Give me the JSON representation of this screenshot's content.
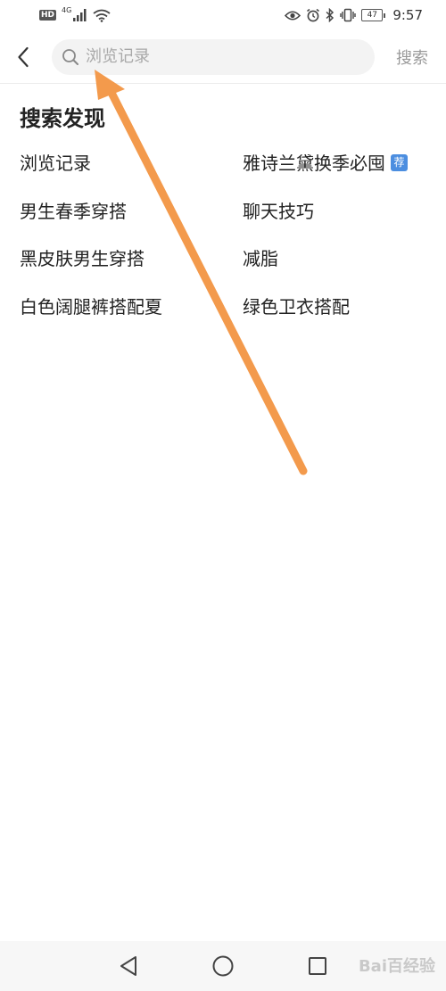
{
  "status_bar": {
    "hd": "HD",
    "network": "4G",
    "battery": "47",
    "time": "9:57"
  },
  "search": {
    "placeholder": "浏览记录",
    "value": "",
    "button_label": "搜索"
  },
  "discover": {
    "title": "搜索发现",
    "badge": "荐",
    "items": [
      {
        "label": "浏览记录"
      },
      {
        "label": "雅诗兰黛换季必囤"
      },
      {
        "label": "男生春季穿搭"
      },
      {
        "label": "聊天技巧"
      },
      {
        "label": "黑皮肤男生穿搭"
      },
      {
        "label": "减脂"
      },
      {
        "label": "白色阔腿裤搭配夏"
      },
      {
        "label": "绿色卫衣搭配"
      }
    ]
  },
  "watermark": {
    "text": "Bai百经验"
  },
  "colors": {
    "arrow": "#f39a4c",
    "badge": "#4c8ee0",
    "search_bg": "#f3f3f3",
    "nav_bg": "#f7f7f7"
  },
  "icons": {
    "back": "chevron-left-icon",
    "search": "search-icon",
    "nav_back": "triangle-back-icon",
    "nav_home": "circle-home-icon",
    "nav_recent": "square-recent-icon"
  }
}
